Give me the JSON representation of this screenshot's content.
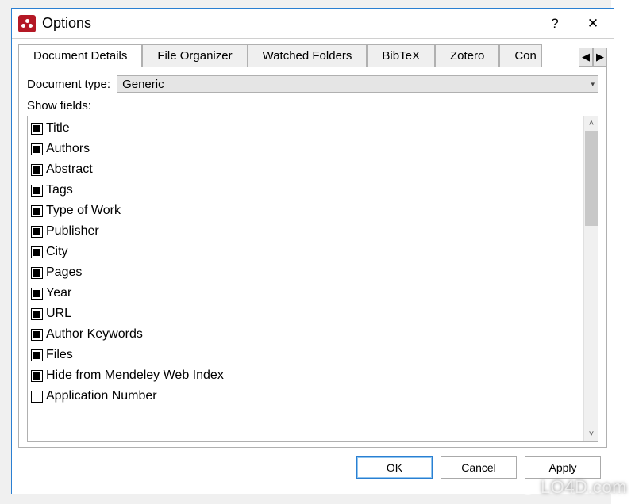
{
  "window": {
    "title": "Options",
    "help_symbol": "?",
    "close_symbol": "✕"
  },
  "tabs": [
    "Document Details",
    "File Organizer",
    "Watched Folders",
    "BibTeX",
    "Zotero",
    "Con"
  ],
  "active_tab_index": 0,
  "tab_spinner": {
    "left": "◀",
    "right": "▶"
  },
  "doctype": {
    "label": "Document type:",
    "value": "Generic"
  },
  "show_fields_label": "Show fields:",
  "fields": [
    {
      "label": "Title",
      "checked": true
    },
    {
      "label": "Authors",
      "checked": true
    },
    {
      "label": "Abstract",
      "checked": true
    },
    {
      "label": "Tags",
      "checked": true
    },
    {
      "label": "Type of Work",
      "checked": true
    },
    {
      "label": "Publisher",
      "checked": true
    },
    {
      "label": "City",
      "checked": true
    },
    {
      "label": "Pages",
      "checked": true
    },
    {
      "label": "Year",
      "checked": true
    },
    {
      "label": "URL",
      "checked": true
    },
    {
      "label": "Author Keywords",
      "checked": true
    },
    {
      "label": "Files",
      "checked": true
    },
    {
      "label": "Hide from Mendeley Web Index",
      "checked": true
    },
    {
      "label": "Application Number",
      "checked": false
    }
  ],
  "scroll": {
    "up": "⌃",
    "down": "⌄"
  },
  "buttons": {
    "ok": "OK",
    "cancel": "Cancel",
    "apply": "Apply"
  },
  "watermark": "LO4D.com"
}
